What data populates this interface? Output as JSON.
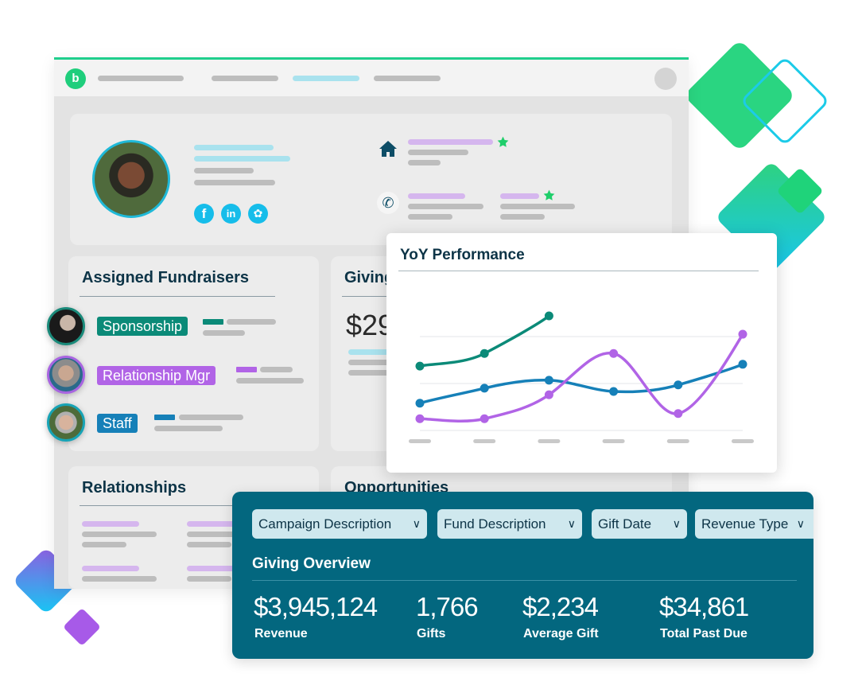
{
  "app": {
    "logo_letter": "b",
    "brand_color": "#1fce7c",
    "accent_teal": "#03677f"
  },
  "profile": {
    "social_icons": [
      "facebook-icon",
      "linkedin-icon",
      "twitter-icon"
    ],
    "contact_icons": [
      "home-icon",
      "phone-icon",
      "star-icon"
    ]
  },
  "fundraisers": {
    "title": "Assigned Fundraisers",
    "items": [
      {
        "label": "Sponsorship",
        "color": "#0b8a78"
      },
      {
        "label": "Relationship Mgr",
        "color": "#b164e6"
      },
      {
        "label": "Staff",
        "color": "#1680b8"
      }
    ]
  },
  "giving_card": {
    "title": "Giving",
    "value": "$29"
  },
  "relationships": {
    "title": "Relationships"
  },
  "opportunities": {
    "title": "Opportunities"
  },
  "yoy": {
    "title": "YoY Performance"
  },
  "chart_data": {
    "type": "line",
    "title": "YoY Performance",
    "xlabel": "",
    "ylabel": "",
    "categories": [
      "",
      "",
      "",
      "",
      "",
      ""
    ],
    "ylim": [
      0,
      3
    ],
    "grid": true,
    "series": [
      {
        "color": "#0b8a78",
        "values": [
          1.37,
          1.64,
          2.44,
          null,
          null,
          null
        ]
      },
      {
        "color": "#1680b8",
        "values": [
          0.58,
          0.9,
          1.07,
          0.83,
          0.97,
          1.41
        ]
      },
      {
        "color": "#b164e6",
        "values": [
          0.25,
          0.25,
          0.76,
          1.64,
          0.36,
          2.05
        ]
      }
    ]
  },
  "overview": {
    "filters": [
      {
        "label": "Campaign Description"
      },
      {
        "label": "Fund Description"
      },
      {
        "label": "Gift Date"
      },
      {
        "label": "Revenue Type"
      }
    ],
    "title": "Giving Overview",
    "kpis": [
      {
        "value": "$3,945,124",
        "label": "Revenue"
      },
      {
        "value": "1,766",
        "label": "Gifts"
      },
      {
        "value": "$2,234",
        "label": "Average Gift"
      },
      {
        "value": "$34,861",
        "label": "Total Past Due"
      }
    ]
  }
}
